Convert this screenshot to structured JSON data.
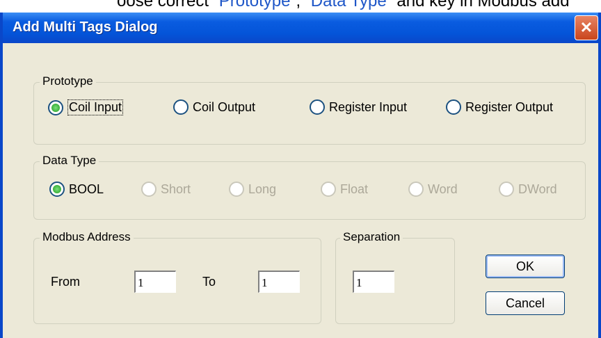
{
  "doc": {
    "prefix": "oose correct “",
    "link1": "Prototype",
    "mid": "”, “",
    "link2": "Data Type",
    "suffix": "” and key in Modbus add"
  },
  "dialog": {
    "title": "Add Multi Tags Dialog",
    "close_glyph": "✕"
  },
  "prototype": {
    "legend": "Prototype",
    "options": [
      "Coil Input",
      "Coil Output",
      "Register Input",
      "Register Output"
    ],
    "selected": "Coil Input"
  },
  "data_type": {
    "legend": "Data Type",
    "options": [
      "BOOL",
      "Short",
      "Long",
      "Float",
      "Word",
      "DWord"
    ],
    "selected": "BOOL"
  },
  "modbus": {
    "legend": "Modbus Address",
    "from_label": "From",
    "from_value": "1",
    "to_label": "To",
    "to_value": "1"
  },
  "separation": {
    "legend": "Separation",
    "value": "1"
  },
  "buttons": {
    "ok": "OK",
    "cancel": "Cancel"
  }
}
